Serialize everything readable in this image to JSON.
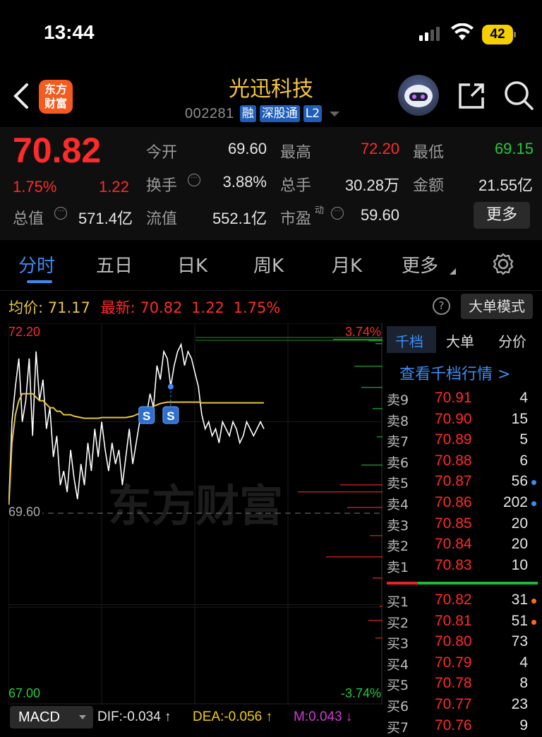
{
  "status": {
    "time": "13:44",
    "battery": "42"
  },
  "header": {
    "logo_line1": "东方",
    "logo_line2": "财富",
    "name": "光迅科技",
    "code": "002281",
    "tags": [
      "融",
      "深股通",
      "L2"
    ]
  },
  "quote": {
    "price": "70.82",
    "pct": "1.75%",
    "change": "1.22",
    "fields": [
      {
        "label": "今开",
        "value": "69.60",
        "color": "#e6e6e6"
      },
      {
        "label": "最高",
        "value": "72.20",
        "color": "#ff2a2a"
      },
      {
        "label": "最低",
        "value": "69.15",
        "color": "#28c83c"
      },
      {
        "label": "换手",
        "value": "3.88%",
        "color": "#e6e6e6"
      },
      {
        "label": "总手",
        "value": "30.28万",
        "color": "#e6e6e6"
      },
      {
        "label": "金额",
        "value": "21.55亿",
        "color": "#e6e6e6"
      },
      {
        "label": "总值",
        "value": "571.4亿",
        "color": "#e6e6e6"
      },
      {
        "label": "流值",
        "value": "552.1亿",
        "color": "#e6e6e6"
      },
      {
        "label": "市盈",
        "sup": "动",
        "value": "59.60",
        "color": "#e6e6e6"
      }
    ],
    "more": "更多"
  },
  "tabs": [
    "分时",
    "五日",
    "日K",
    "周K",
    "月K",
    "更多"
  ],
  "info": {
    "avg_label": "均价:",
    "avg_value": "71.17",
    "latest_label": "最新:",
    "latest_value": "70.82",
    "latest_change": "1.22",
    "latest_pct": "1.75%",
    "help": "?",
    "big_order_mode": "大单模式"
  },
  "chart_data": {
    "type": "line",
    "title": "",
    "y_top": "72.20",
    "y_mid": "69.60",
    "y_bottom": "67.00",
    "pct_top": "3.74%",
    "pct_bottom": "-3.74%",
    "ylim": [
      67.0,
      72.2
    ],
    "base": 69.6,
    "watermark": "东方财富",
    "markers": [
      "S",
      "S"
    ],
    "series": [
      {
        "name": "价格",
        "values": [
          69.6,
          70.9,
          71.4,
          71.8,
          70.9,
          71.2,
          71.8,
          70.7,
          71.9,
          71.2,
          71.5,
          70.8,
          71.1,
          70.4,
          70.7,
          70.0,
          70.2,
          69.9,
          70.5,
          70.1,
          69.8,
          70.3,
          70.0,
          70.6,
          70.2,
          70.8,
          70.4,
          70.9,
          70.5,
          70.2,
          70.6,
          70.3,
          70.5,
          70.0,
          70.4,
          70.8,
          70.3,
          70.6,
          70.9,
          71.0,
          71.0,
          71.3,
          71.1,
          71.7,
          71.5,
          71.9,
          71.8,
          71.4,
          71.7,
          71.9,
          72.0,
          71.7,
          71.9,
          71.8,
          71.6,
          71.4,
          71.0,
          70.8,
          70.9,
          70.7,
          70.8,
          70.6,
          70.9,
          70.8,
          70.7,
          70.9,
          70.8,
          70.6,
          70.7,
          70.9,
          70.8,
          70.7,
          70.8,
          70.9,
          70.8
        ]
      },
      {
        "name": "均价",
        "values": [
          69.6,
          70.6,
          71.0,
          71.2,
          71.3,
          71.3,
          71.3,
          71.3,
          71.25,
          71.2,
          71.2,
          71.15,
          71.1,
          71.1,
          71.05,
          71.05,
          71.0,
          71.0,
          71.0,
          70.98,
          70.97,
          70.96,
          70.95,
          70.95,
          70.95,
          70.95,
          70.95,
          70.96,
          70.96,
          70.96,
          70.96,
          70.96,
          70.96,
          70.96,
          70.96,
          70.97,
          70.98,
          71.0,
          71.02,
          71.05,
          71.08,
          71.1,
          71.12,
          71.14,
          71.16,
          71.17,
          71.18,
          71.18,
          71.18,
          71.18,
          71.18,
          71.18,
          71.18,
          71.18,
          71.18,
          71.18,
          71.17,
          71.17,
          71.17,
          71.17,
          71.17,
          71.17,
          71.17,
          71.17,
          71.17,
          71.17,
          71.17,
          71.17,
          71.17,
          71.17,
          71.17,
          71.17,
          71.17,
          71.17,
          71.17
        ]
      }
    ]
  },
  "order_book": {
    "tabs": [
      "千档",
      "大单",
      "分价"
    ],
    "view_depth": "查看千档行情 >",
    "asks": [
      {
        "label": "卖9",
        "price": "70.91",
        "vol": "4",
        "dot": ""
      },
      {
        "label": "卖8",
        "price": "70.90",
        "vol": "15",
        "dot": ""
      },
      {
        "label": "卖7",
        "price": "70.89",
        "vol": "5",
        "dot": ""
      },
      {
        "label": "卖6",
        "price": "70.88",
        "vol": "6",
        "dot": ""
      },
      {
        "label": "卖5",
        "price": "70.87",
        "vol": "56",
        "dot": "#3d8bf2"
      },
      {
        "label": "卖4",
        "price": "70.86",
        "vol": "202",
        "dot": "#3d8bf2"
      },
      {
        "label": "卖3",
        "price": "70.85",
        "vol": "20",
        "dot": ""
      },
      {
        "label": "卖2",
        "price": "70.84",
        "vol": "20",
        "dot": ""
      },
      {
        "label": "卖1",
        "price": "70.83",
        "vol": "10",
        "dot": ""
      }
    ],
    "bids": [
      {
        "label": "买1",
        "price": "70.82",
        "vol": "31",
        "dot": "#ff6a1a"
      },
      {
        "label": "买2",
        "price": "70.81",
        "vol": "51",
        "dot": "#ff6a1a"
      },
      {
        "label": "买3",
        "price": "70.80",
        "vol": "73",
        "dot": ""
      },
      {
        "label": "买4",
        "price": "70.79",
        "vol": "4",
        "dot": ""
      },
      {
        "label": "买5",
        "price": "70.78",
        "vol": "8",
        "dot": ""
      },
      {
        "label": "买6",
        "price": "70.77",
        "vol": "23",
        "dot": ""
      },
      {
        "label": "买7",
        "price": "70.76",
        "vol": "9",
        "dot": ""
      }
    ]
  },
  "macd": {
    "selector": "MACD",
    "dif": "DIF:-0.034 ↑",
    "dea": "DEA:-0.056 ↑",
    "m": "M:0.043 ↓"
  }
}
